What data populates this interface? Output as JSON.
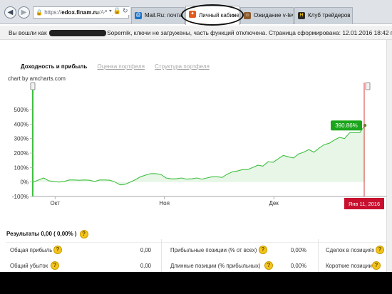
{
  "browser": {
    "address": {
      "protocol": "https://",
      "host": "edox.finam.ru",
      "path": "/Analytic"
    },
    "tabs": [
      {
        "label": "Mail.Ru: почта, пои...",
        "favicon": "mail-ru-icon"
      },
      {
        "label": "Личный кабине...",
        "favicon": "finam-icon",
        "active": true
      },
      {
        "label": "Ожидание v-levch...",
        "favicon": "wait-icon"
      },
      {
        "label": "Клуб трейдеров s...",
        "favicon": "traders-club-icon"
      }
    ],
    "tab_close": "×"
  },
  "notice": {
    "before": "Вы вошли как",
    "after": "Sopernik, ключи не загружены, часть функций отключена. Страница сформирована: 12.01.2016 18:42 по серверу."
  },
  "page_tabs": [
    {
      "label": "Доходность и прибыль",
      "active": true
    },
    {
      "label": "Оценка портфеля"
    },
    {
      "label": "Структура портфеля"
    }
  ],
  "chart_credit": "chart by amcharts.com",
  "chart_data": {
    "type": "area",
    "x_labels": [
      "Окт",
      "Ноя",
      "Дек"
    ],
    "y_ticks": [
      "-100%",
      "0%",
      "100%",
      "200%",
      "300%",
      "400%",
      "500%"
    ],
    "ylim": [
      -100,
      500
    ],
    "y_unit": "%",
    "grid": false,
    "values": [
      0,
      14,
      28,
      8,
      4,
      0,
      4,
      14,
      14,
      12,
      14,
      12,
      4,
      14,
      14,
      12,
      0,
      -20,
      -16,
      0,
      16,
      36,
      48,
      58,
      58,
      52,
      28,
      22,
      22,
      28,
      20,
      22,
      28,
      20,
      28,
      36,
      36,
      32,
      54,
      70,
      76,
      86,
      86,
      100,
      116,
      110,
      140,
      136,
      160,
      184,
      174,
      166,
      194,
      206,
      224,
      206,
      234,
      258,
      268,
      290,
      308,
      300,
      340,
      341,
      341,
      390.86
    ],
    "last_value_label": "390.86%",
    "cursor_date": "Янв 11, 2016",
    "line_color": "#3fbf3f",
    "fill_color": "#e7f6e7",
    "cursor_color": "#d93b3b",
    "balloon_color": "#1aa51a"
  },
  "results": {
    "title": "Результаты 0,00 ( 0,00% )",
    "help_icon": "?",
    "rows": [
      {
        "label": "Общая прибыль",
        "value": "0,00"
      },
      {
        "label": "Общий убыток",
        "value": "0,00"
      }
    ],
    "rows_mid": [
      {
        "label": "Прибыльные позиции (% от всех)",
        "value": "0,00%"
      },
      {
        "label": "Длинные позиции (% прибыльных)",
        "value": "0,00%"
      }
    ],
    "rows_right": [
      {
        "label": "Сделок в позициях"
      },
      {
        "label": "Короткие позиции"
      }
    ]
  }
}
